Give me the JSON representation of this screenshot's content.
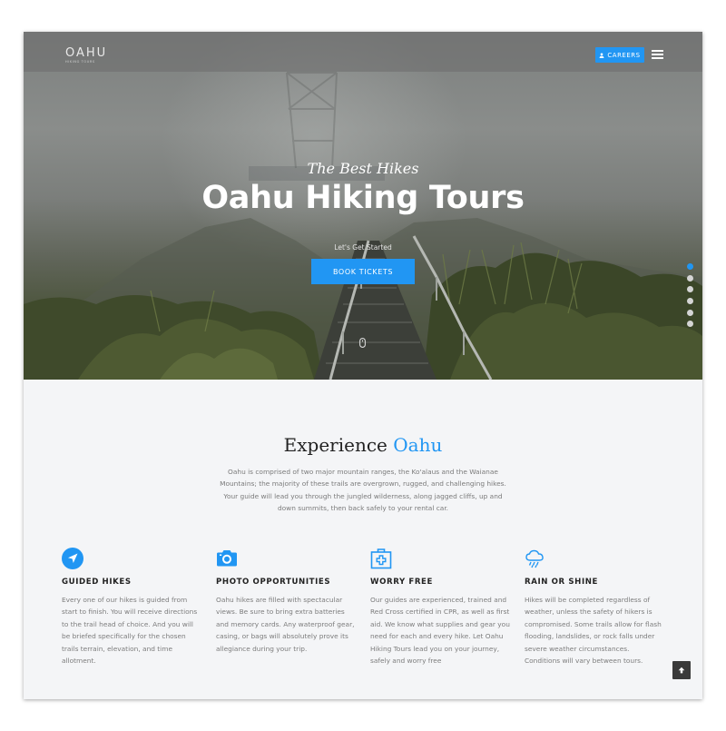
{
  "header": {
    "logo": "OAHU",
    "logo_tagline": "HIKING TOURS",
    "careers_label": "CAREERS",
    "careers_icon": "user-icon",
    "menu_icon": "hamburger-menu-icon"
  },
  "hero": {
    "kicker": "The Best Hikes",
    "title": "Oahu Hiking Tours",
    "subtitle": "Let's Get Started",
    "cta_label": "BOOK TICKETS",
    "scroll_icon": "mouse-scroll-icon",
    "slides": {
      "count": 6,
      "active_index": 0
    }
  },
  "intro": {
    "title_main": "Experience ",
    "title_accent": "Oahu",
    "body": "Oahu is comprised of two major mountain ranges, the Ko'alaus and the Waianae Mountains; the majority of these trails are overgrown, rugged, and challenging hikes. Your guide will lead you through the jungled wilderness, along jagged cliffs, up and down summits, then back safely to your rental car."
  },
  "features": [
    {
      "icon": "navigation-arrow-icon",
      "title": "GUIDED HIKES",
      "text": "Every one of our hikes is guided from start to finish. You will receive directions to the trail head of choice. And you will be briefed specifically for the chosen trails terrain, elevation, and time allotment."
    },
    {
      "icon": "camera-icon",
      "title": "PHOTO OPPORTUNITIES",
      "text": "Oahu hikes are filled with spectacular views. Be sure to bring extra batteries and memory cards. Any waterproof gear, casing, or bags will absolutely prove its allegiance during your trip."
    },
    {
      "icon": "first-aid-kit-icon",
      "title": "WORRY FREE",
      "text": "Our guides are experienced, trained and Red Cross certified in CPR, as well as first aid. We know what supplies and gear you need for each and every hike. Let Oahu Hiking Tours lead you on your journey, safely and worry free"
    },
    {
      "icon": "rain-cloud-icon",
      "title": "RAIN OR SHINE",
      "text": "Hikes will be completed regardless of weather, unless the safety of hikers is compromised. Some trails allow for flash flooding, landslides, or rock falls under severe weather circumstances. Conditions will vary between tours."
    }
  ],
  "back_to_top_icon": "arrow-up-icon",
  "colors": {
    "accent": "#2196f3",
    "dark": "#222222",
    "muted_text": "#7c7c7c"
  }
}
